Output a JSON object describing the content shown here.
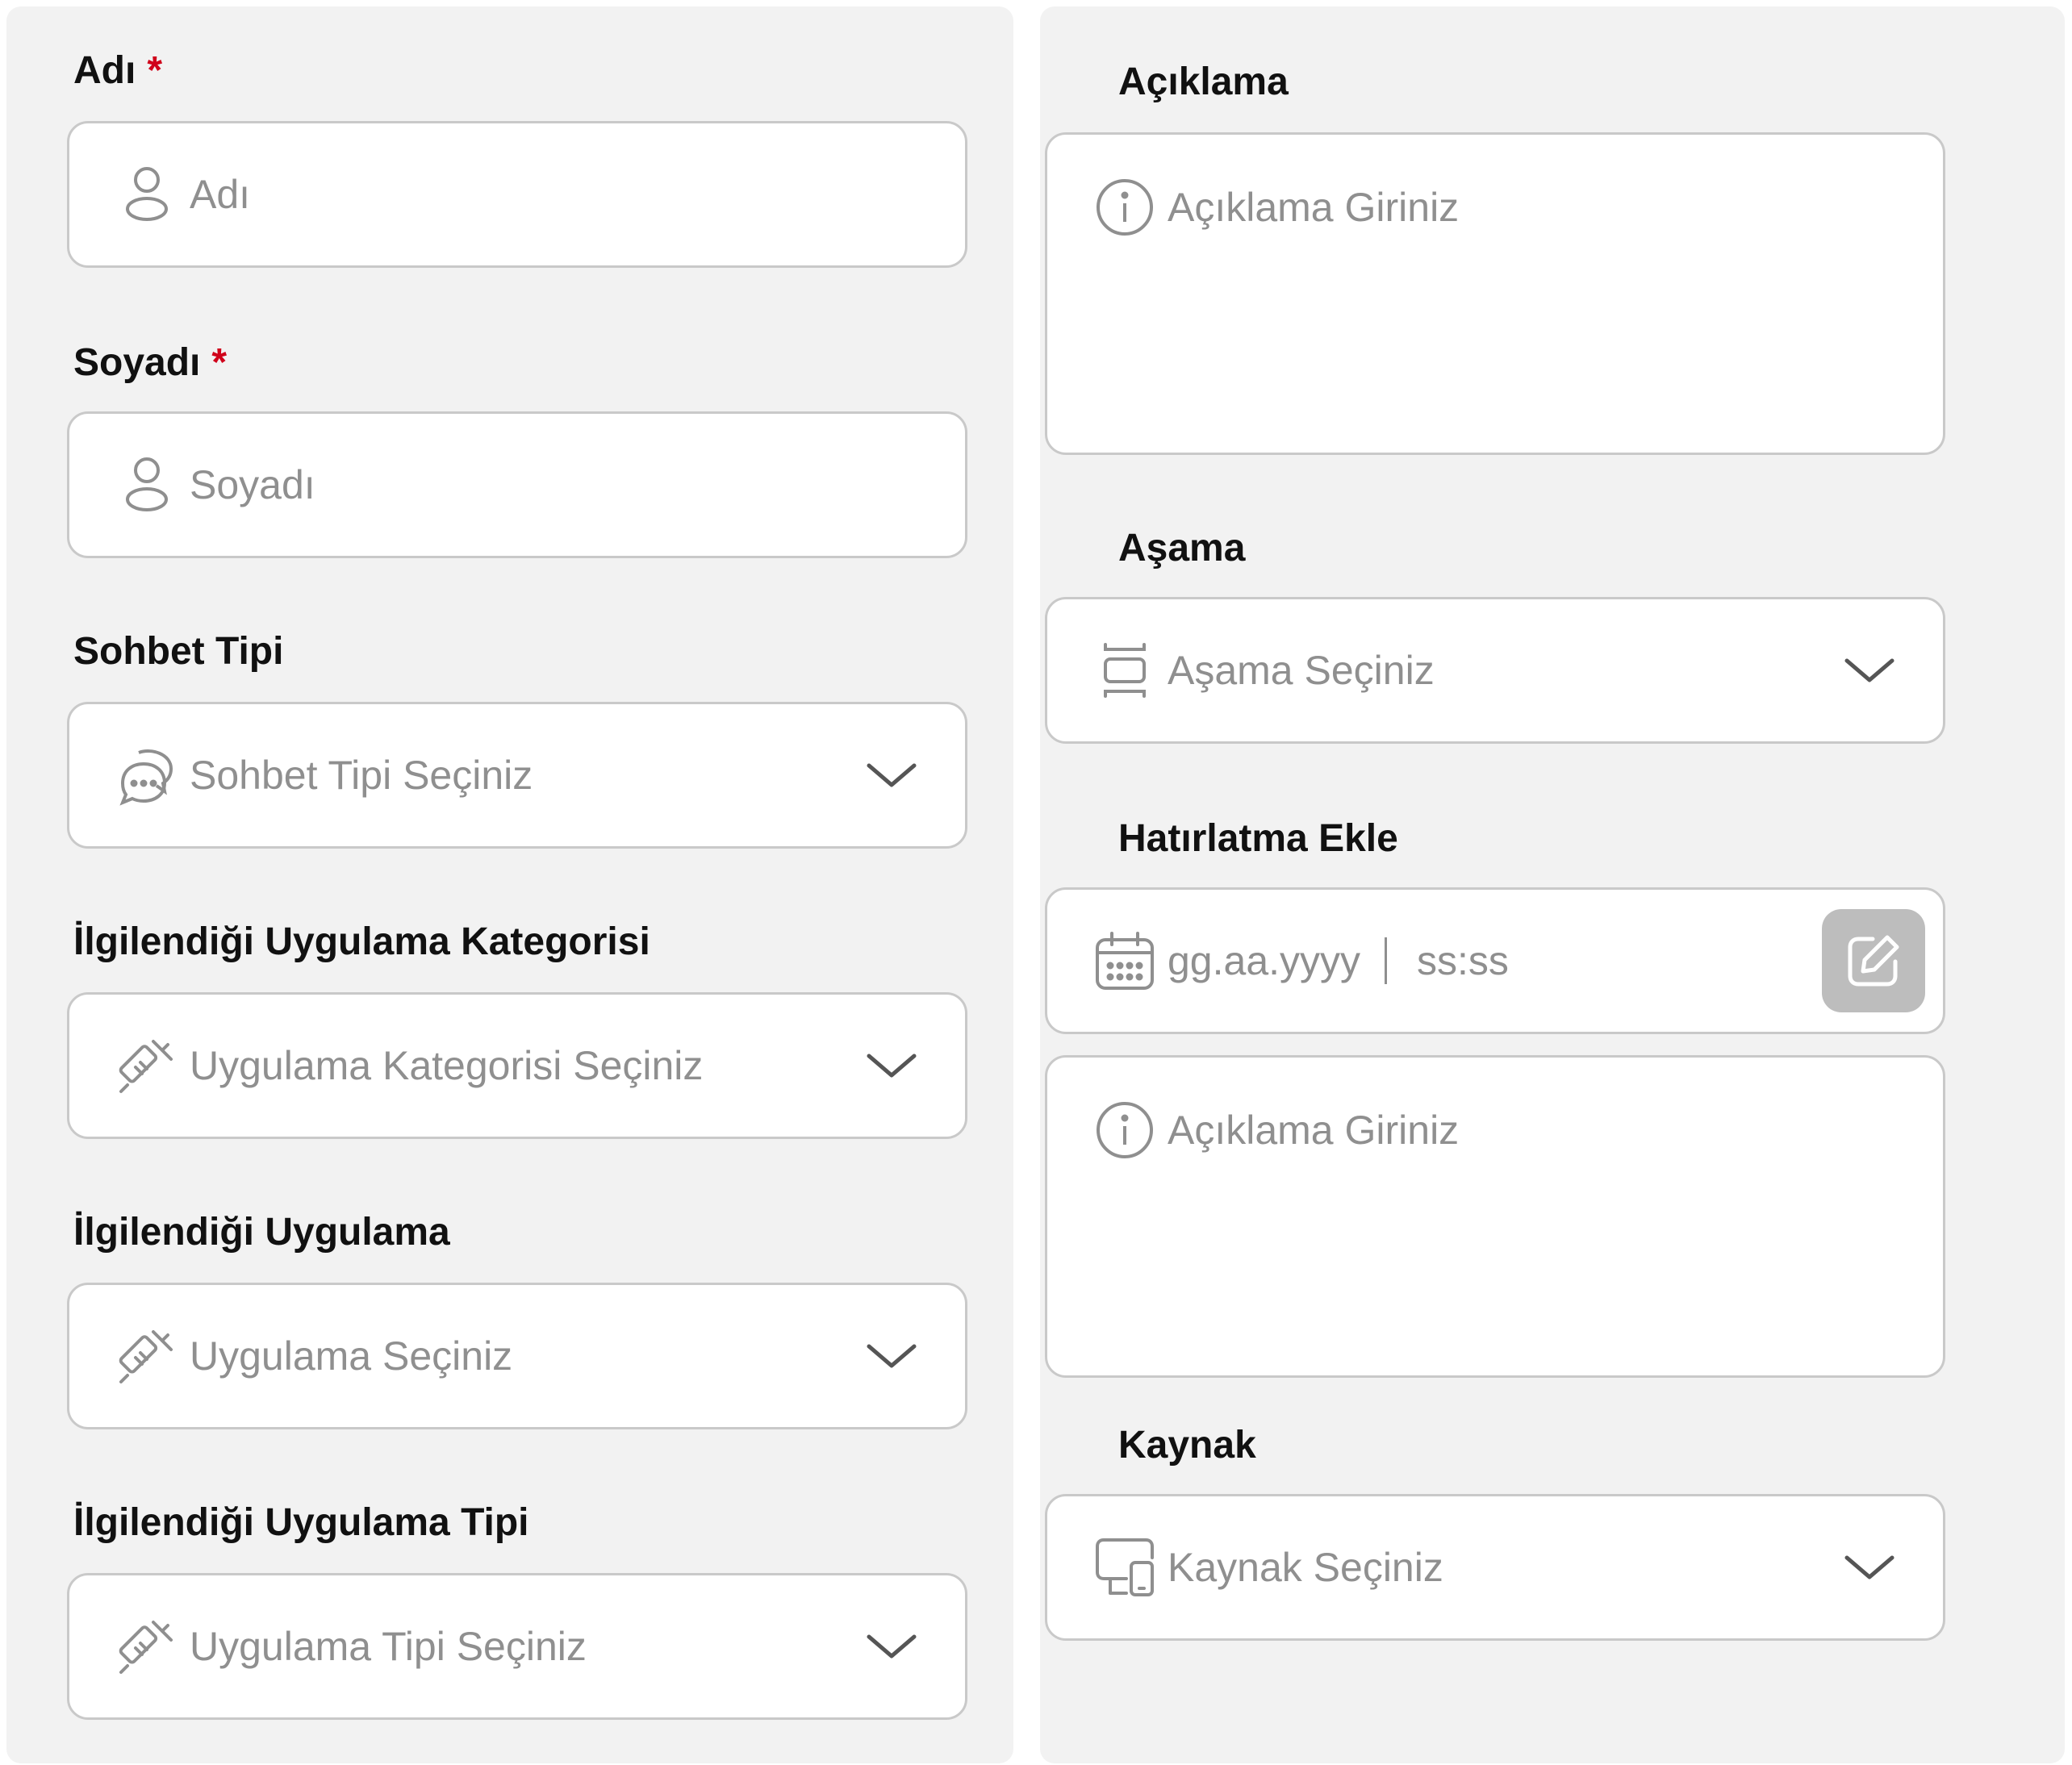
{
  "left": {
    "first_name": {
      "label": "Adı",
      "required_mark": "*",
      "placeholder": "Adı",
      "icon": "user-icon"
    },
    "last_name": {
      "label": "Soyadı",
      "required_mark": "*",
      "placeholder": "Soyadı",
      "icon": "user-icon"
    },
    "chat_type": {
      "label": "Sohbet Tipi",
      "placeholder": "Sohbet Tipi Seçiniz",
      "icon": "chat-bubbles-icon"
    },
    "app_category": {
      "label": "İlgilendiği Uygulama Kategorisi",
      "placeholder": "Uygulama Kategorisi Seçiniz",
      "icon": "syringe-icon"
    },
    "app": {
      "label": "İlgilendiği Uygulama",
      "placeholder": "Uygulama Seçiniz",
      "icon": "syringe-icon"
    },
    "app_type": {
      "label": "İlgilendiği Uygulama Tipi",
      "placeholder": "Uygulama Tipi Seçiniz",
      "icon": "syringe-icon"
    }
  },
  "right": {
    "description": {
      "label": "Açıklama",
      "placeholder": "Açıklama Giriniz",
      "icon": "info-icon"
    },
    "stage": {
      "label": "Aşama",
      "placeholder": "Aşama Seçiniz",
      "icon": "stage-icon"
    },
    "reminder": {
      "label": "Hatırlatma Ekle",
      "date_placeholder": "gg.aa.yyyy",
      "time_placeholder": "ss:ss",
      "note_placeholder": "Açıklama Giriniz",
      "icon": "calendar-icon"
    },
    "source": {
      "label": "Kaynak",
      "placeholder": "Kaynak Seçiniz",
      "icon": "devices-icon"
    }
  },
  "colors": {
    "panel": "#f2f2f2",
    "border": "#c9c9c9",
    "placeholder": "#8f8f8f",
    "required": "#d0021b",
    "edit_button": "#bdbdbd"
  }
}
